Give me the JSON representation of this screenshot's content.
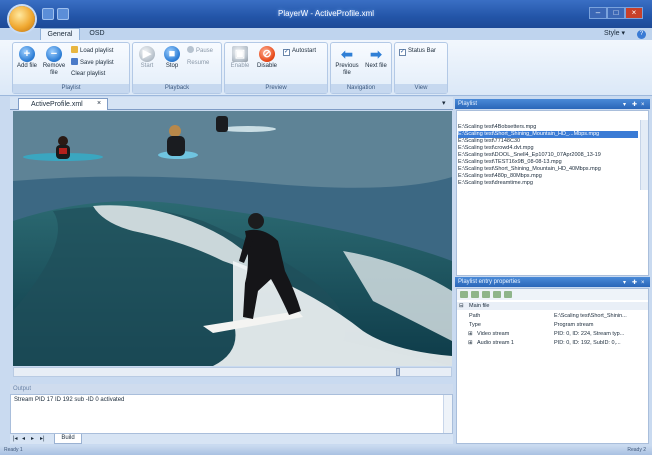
{
  "window": {
    "title": "PlayerW - ActiveProfile.xml"
  },
  "ribbon": {
    "tabs": [
      "General",
      "OSD"
    ],
    "style_label": "Style",
    "help_glyph": "?",
    "groups": {
      "playlist": {
        "name": "Playlist",
        "add": "Add file",
        "remove": "Remove file",
        "load": "Load playlist",
        "save": "Save playlist",
        "clear": "Clear playlist"
      },
      "playback": {
        "name": "Playback",
        "start": "Start",
        "stop": "Stop",
        "pause": "Pause",
        "resume": "Resume"
      },
      "preview": {
        "name": "Preview",
        "enable": "Enable",
        "disable": "Disable",
        "autostart": "Autostart"
      },
      "navigation": {
        "name": "Navigation",
        "previous": "Previous file",
        "next": "Next file"
      },
      "view": {
        "name": "View",
        "status_bar": "Status Bar"
      }
    }
  },
  "document": {
    "tab_label": "ActiveProfile.xml",
    "close_glyph": "×"
  },
  "output": {
    "title": "Output",
    "line": "Stream PID 17 ID 192 sub -ID 0 activated"
  },
  "bottom_tabs": {
    "build": "Build",
    "nav": [
      "|◂",
      "◂",
      "▸",
      "▸|"
    ]
  },
  "status": {
    "left": "Ready 1",
    "right": "Ready 2"
  },
  "playlist": {
    "title": "Playlist",
    "items": [
      "E:\\Scaling test\\4Bobsetters.mpg",
      "E:\\Scaling test\\Short_Shining_Mountain_HD_...Mbps.mpg",
      "E:\\Scaling test\\77148C30",
      "E:\\Scaling test\\crowd4.dvt.mpg",
      "E:\\Scaling test\\DOOL_Snell4_Ep10710_07Apr2008_13-19",
      "E:\\Scaling test\\TEST16x9B_08-08-13.mpg",
      "E:\\Scaling test\\Short_Shining_Mountain_HD_40Mbps.mpg",
      "E:\\Scaling test\\480p_80Mbps.mpg",
      "E:\\Scaling test\\dreamtime.mpg"
    ],
    "selected_index": 1
  },
  "properties": {
    "title": "Playlist entry properties",
    "category": "Main file",
    "rows": [
      {
        "key": "Path",
        "value": "E:\\Scaling test\\Short_Shinin..."
      },
      {
        "key": "Type",
        "value": "Program stream"
      },
      {
        "key": "Video stream",
        "value": "PID: 0, ID: 224, Stream typ..."
      },
      {
        "key": "Audio stream 1",
        "value": "PID: 0, ID: 192, SubID: 0,..."
      }
    ]
  },
  "colors": {
    "accent": "#2a66b8",
    "selection": "#3a7bd5",
    "ribbon_bg": "#dbe8f7"
  },
  "icons": [
    "app-orb-icon",
    "add-icon",
    "remove-icon",
    "start-icon",
    "stop-icon",
    "disable-icon",
    "previous-arrow-icon",
    "next-arrow-icon"
  ]
}
